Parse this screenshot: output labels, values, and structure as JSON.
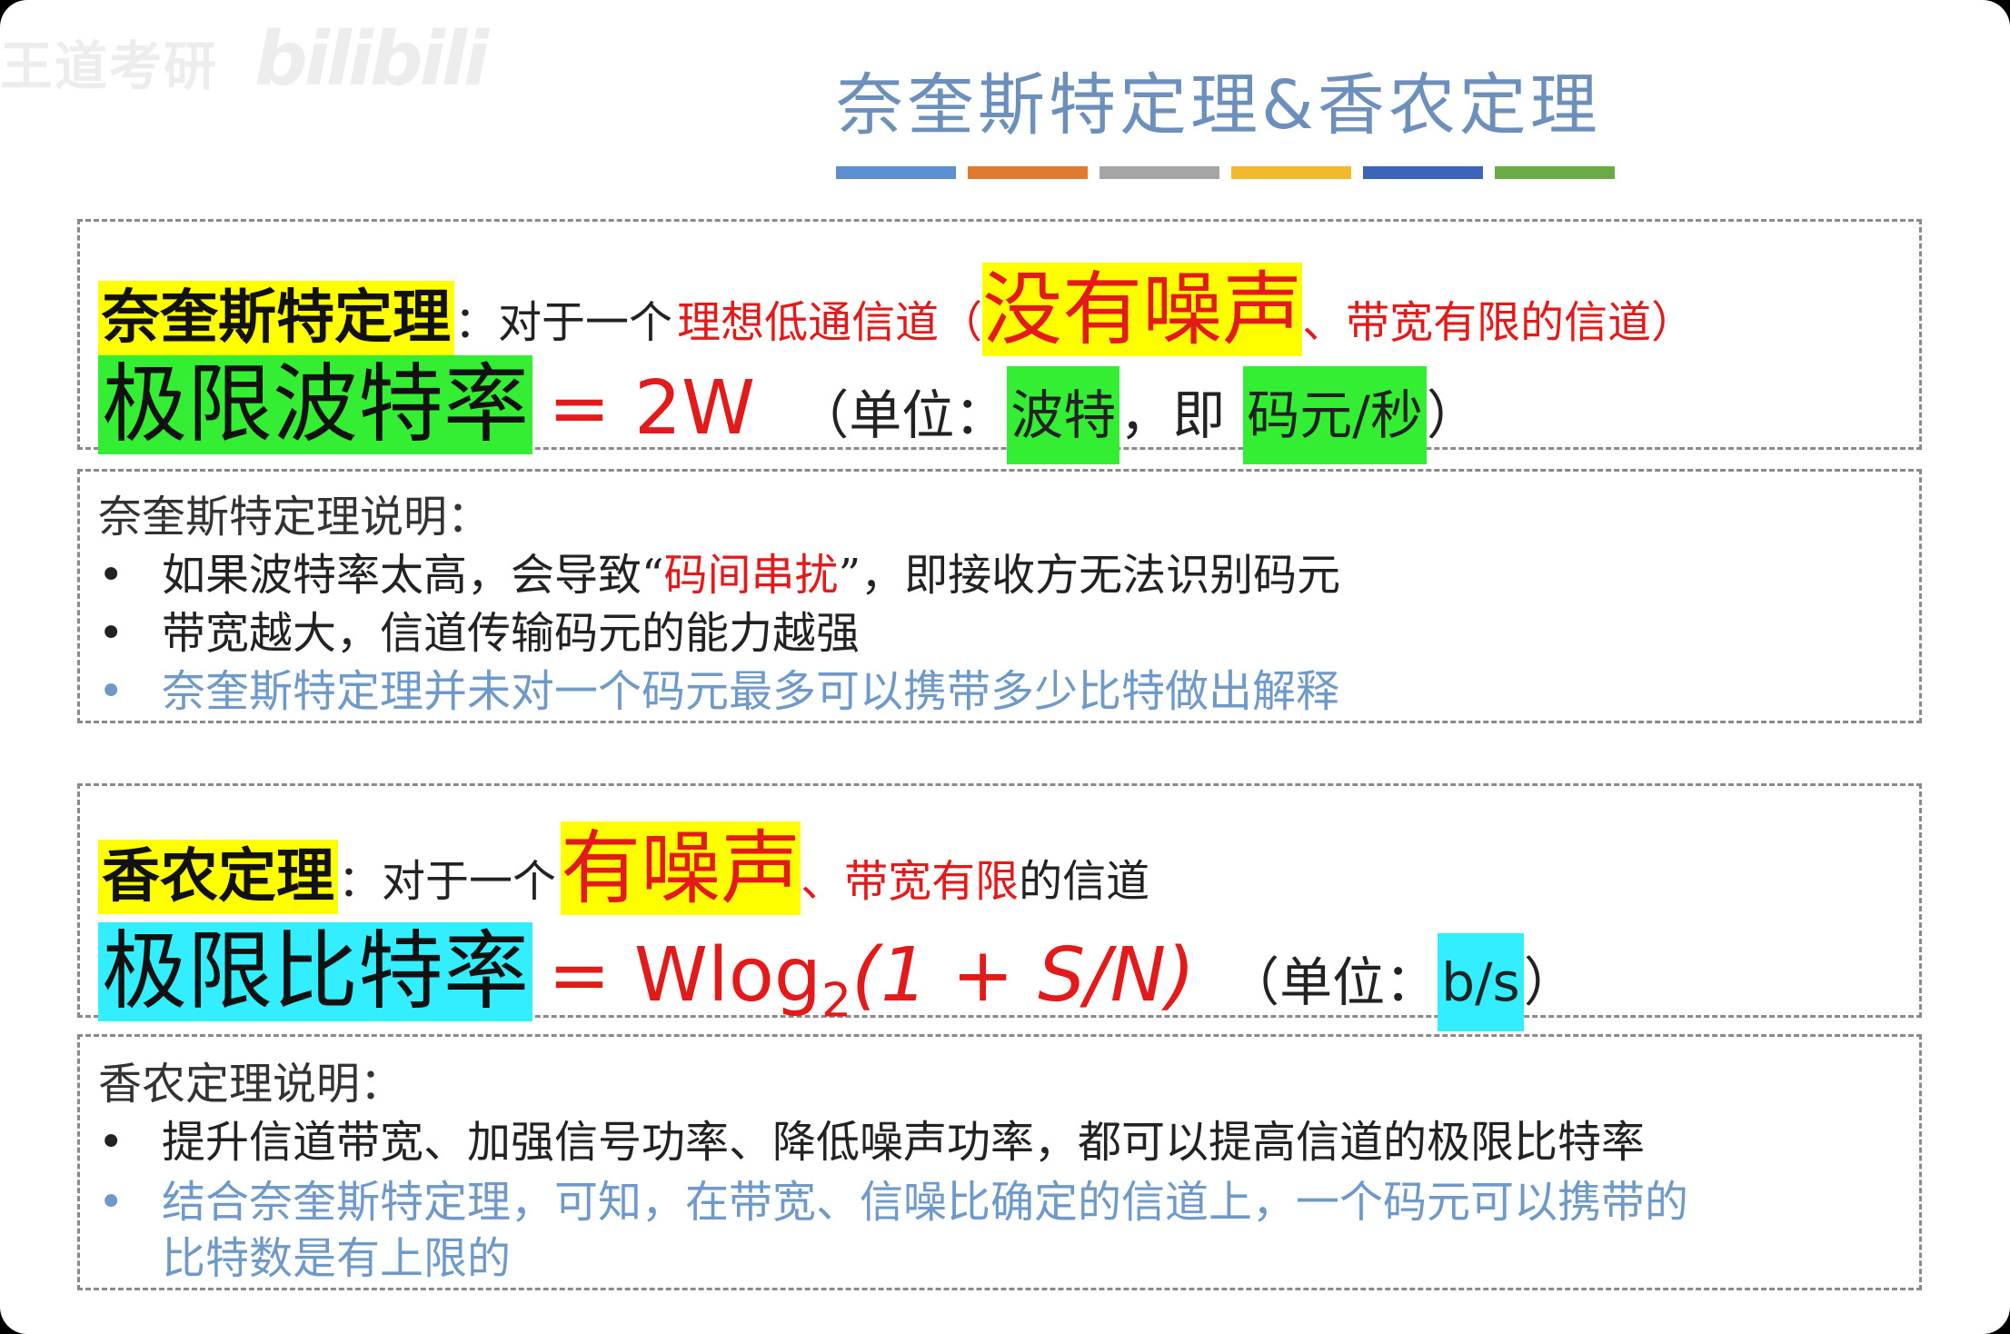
{
  "watermark": {
    "text": "王道考研",
    "logo": "bilibili"
  },
  "title": "奈奎斯特定理&香农定理",
  "title_bar_colors": [
    "#5b8fd0",
    "#e07a2e",
    "#a5a5a5",
    "#f2b92e",
    "#3d64b8",
    "#6bab45"
  ],
  "nyquist": {
    "keyword": "奈奎斯特定理",
    "colon": "：",
    "intro": "对于一个",
    "channel_prefix": "理想低通信道（",
    "no_noise": "没有噪声",
    "channel_suffix": "、带宽有限的信道）",
    "limit_label": "极限波特率",
    "formula": "= 2W",
    "unit_open": "（单位：",
    "unit_baud": "波特",
    "unit_sep": "，即",
    "unit_symbol": "码元/秒",
    "unit_close": "）"
  },
  "nyquist_notes": {
    "heading": "奈奎斯特定理说明：",
    "bullets": [
      {
        "dot": "•",
        "pre": "如果波特率太高，会导致“",
        "highlight": "码间串扰",
        "post": "”，即接收方无法识别码元"
      },
      {
        "dot": "•",
        "text": "带宽越大，信道传输码元的能力越强"
      },
      {
        "dot": "•",
        "text": "奈奎斯特定理并未对一个码元最多可以携带多少比特做出解释"
      }
    ]
  },
  "shannon": {
    "keyword": "香农定理",
    "colon": "：",
    "intro": "对于一个",
    "noise": "有噪声",
    "channel_mid": "、带宽有限",
    "channel_end": "的信道",
    "limit_label": "极限比特率",
    "formula_pre": "= Wlog",
    "formula_sub": "2",
    "formula_post": "(1 + S/N)",
    "unit_open": "（单位：",
    "unit": "b/s",
    "unit_close": "）"
  },
  "shannon_notes": {
    "heading": "香农定理说明：",
    "bullets": [
      {
        "dot": "•",
        "text": "提升信道带宽、加强信号功率、降低噪声功率，都可以提高信道的极限比特率"
      },
      {
        "dot": "•",
        "line1": "结合奈奎斯特定理，可知，在带宽、信噪比确定的信道上，一个码元可以携带的",
        "line2": "比特数是有上限的"
      }
    ]
  }
}
